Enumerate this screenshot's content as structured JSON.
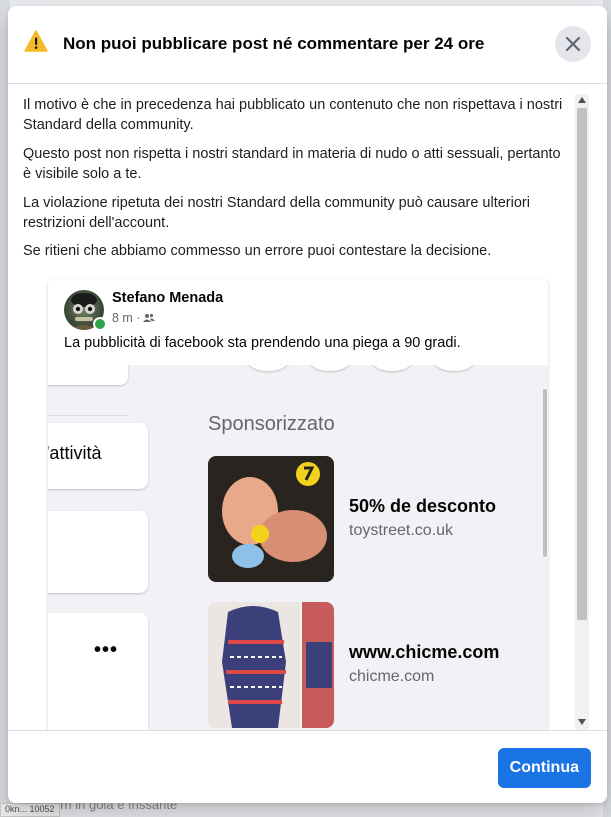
{
  "dialog": {
    "title": "Non puoi pubblicare post né commentare per 24 ore",
    "paragraphs": [
      "Il motivo è che in precedenza hai pubblicato un contenuto che non rispettava i nostri Standard della community.",
      "Questo post non rispetta i nostri standard in materia di nudo o atti sessuali, pertanto è visibile solo a te.",
      "La violazione ripetuta dei nostri Standard della community può causare ulteriori restrizioni dell'account.",
      "Se ritieni che abbiamo commesso un errore puoi contestare la decisione."
    ],
    "continue_label": "Continua"
  },
  "post": {
    "author": "Stefano Menada",
    "time": "8 m ·",
    "text": "La pubblicità di facebook sta prendendo una piega a 90 gradi.",
    "screenshot": {
      "activity_label": "'attività",
      "more_label": "•••",
      "sponsored_title": "Sponsorizzato",
      "ads": [
        {
          "title": "50% de desconto",
          "domain": "toystreet.co.uk"
        },
        {
          "title": "www.chicme.com",
          "domain": "chicme.com"
        }
      ]
    }
  },
  "background": {
    "bottom_text": "Sussurri in gola e frissante",
    "status_text": "0kn... 10052"
  },
  "colors": {
    "accent": "#1b74e4",
    "warning": "#f7b928",
    "online": "#31a24c"
  }
}
